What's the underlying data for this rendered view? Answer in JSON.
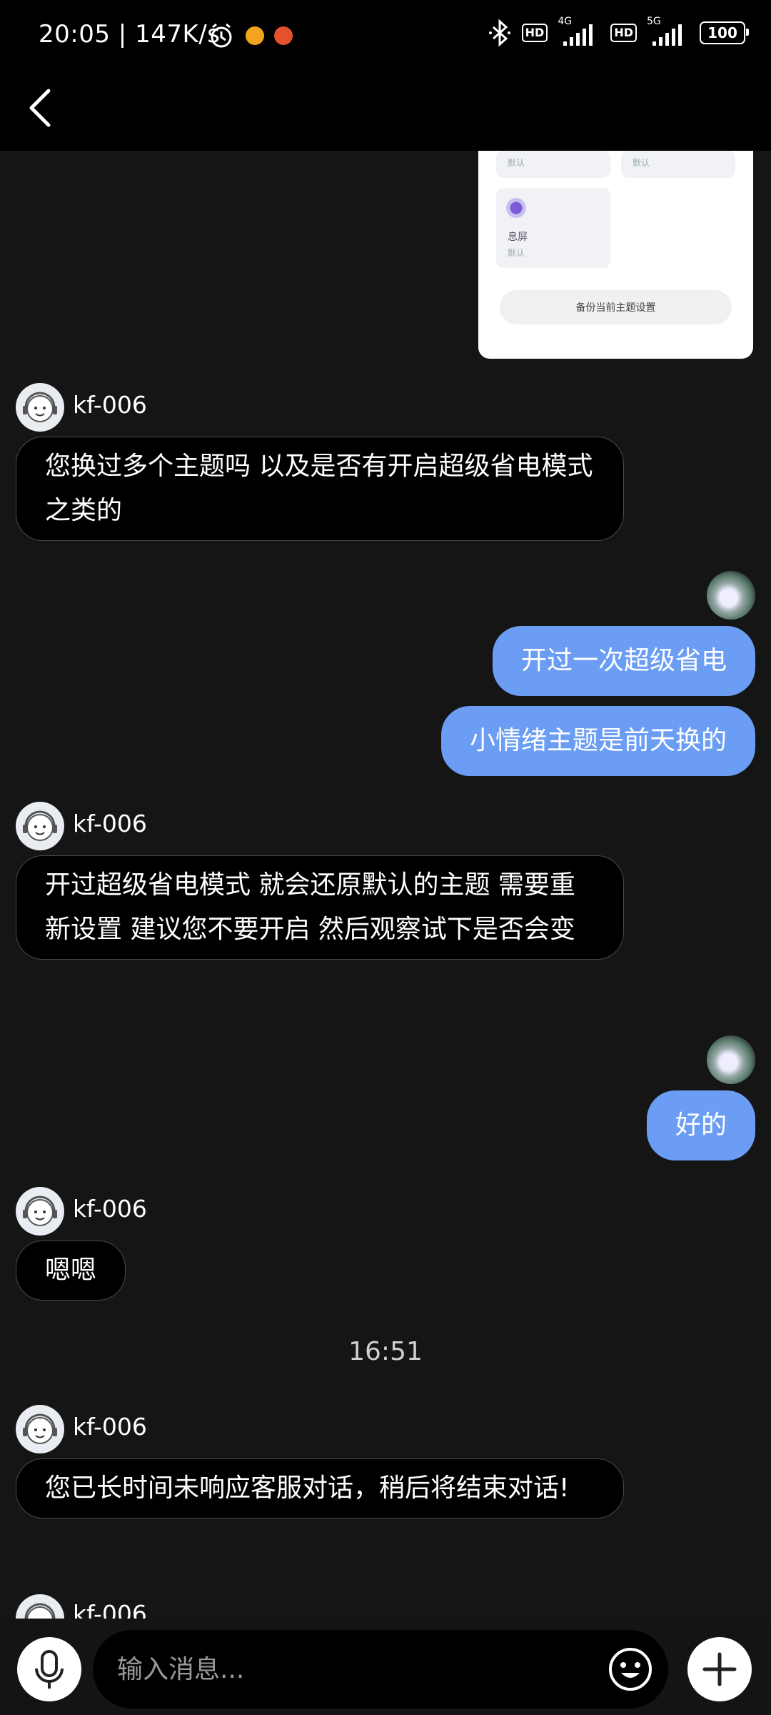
{
  "status_bar": {
    "time": "20:05",
    "speed": "147K/s",
    "hd1": "HD",
    "net1": "4G",
    "hd2": "HD",
    "net2": "5G",
    "battery": "100"
  },
  "screenshot_card": {
    "tile1_sub": "默认",
    "tile2_sub": "默认",
    "tile3_title": "息屏",
    "tile3_sub": "默认",
    "button_label": "备份当前主题设置"
  },
  "messages": [
    {
      "side": "left",
      "sender": "kf-006",
      "text": "您换过多个主题吗 以及是否有开启超级省电模式之类的"
    },
    {
      "side": "right",
      "text": "开过一次超级省电"
    },
    {
      "side": "right",
      "text": "小情绪主题是前天换的"
    },
    {
      "side": "left",
      "sender": "kf-006",
      "text": "开过超级省电模式 就会还原默认的主题 需要重新设置 建议您不要开启 然后观察试下是否会变"
    },
    {
      "side": "right",
      "text": "好的"
    },
    {
      "side": "left",
      "sender": "kf-006",
      "text": "嗯嗯"
    },
    {
      "side": "timestamp",
      "text": "16:51"
    },
    {
      "side": "left",
      "sender": "kf-006",
      "text": "您已长时间未响应客服对话，稍后将结束对话!"
    },
    {
      "side": "left",
      "sender": "kf-006",
      "text": ""
    }
  ],
  "input": {
    "placeholder": "输入消息..."
  },
  "colors": {
    "user_bubble": "#6a9df3",
    "background": "#151515",
    "agent_bubble": "#000000"
  },
  "icons": {
    "back": "chevron-left-icon",
    "mic": "microphone-icon",
    "emoji": "emoji-icon",
    "plus": "plus-icon"
  }
}
